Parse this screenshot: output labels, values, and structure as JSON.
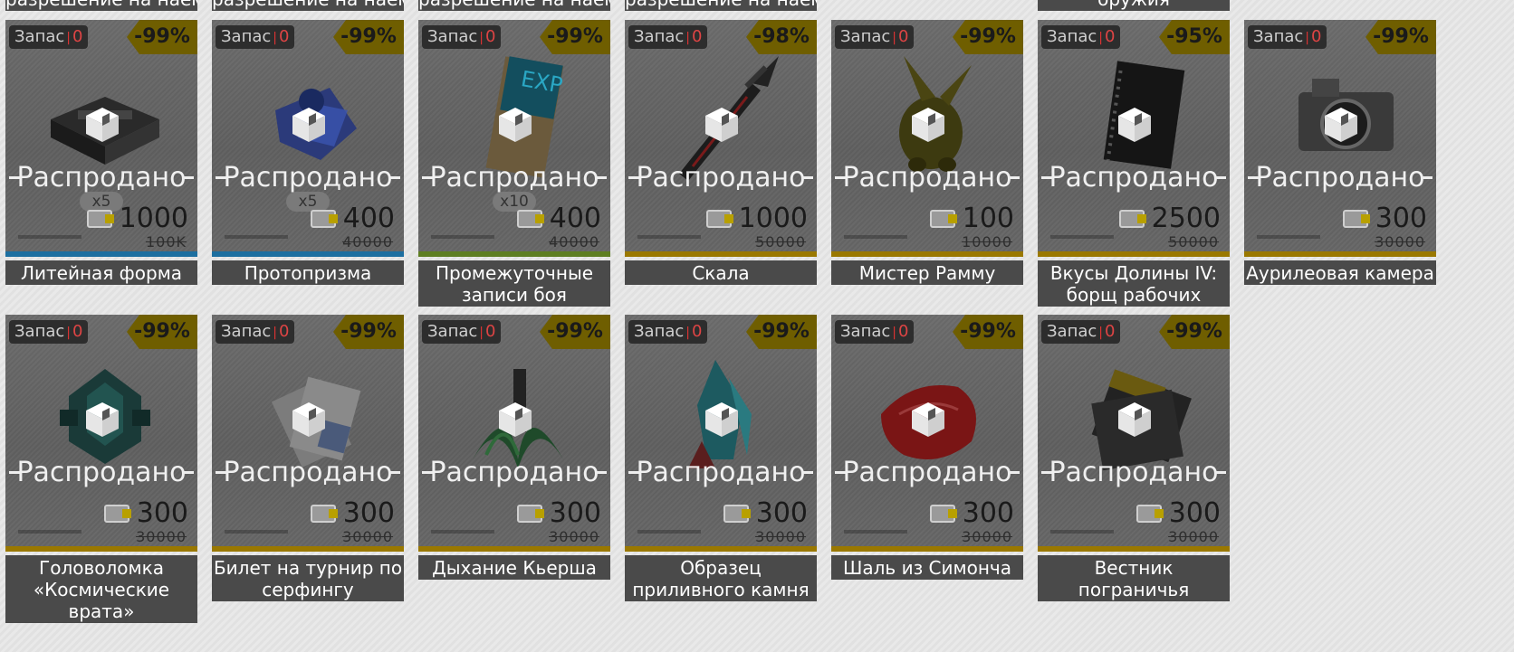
{
  "sold_label": "Распродано",
  "stock_label": "Запас",
  "stock_sep": "|",
  "top_labels": [
    "разрешение на наем",
    "разрешение на наем",
    "разрешение на наем",
    "разрешение на наем",
    "оружия"
  ],
  "rows": [
    [
      {
        "name": "Литейная форма",
        "stock": "0",
        "discount": "-99%",
        "price": "1000",
        "old_price": "100K",
        "qty": "x5",
        "rarity_color": "#1d6fa0",
        "icon": "mold-icon"
      },
      {
        "name": "Протопризма",
        "stock": "0",
        "discount": "-99%",
        "price": "400",
        "old_price": "40000",
        "qty": "x5",
        "rarity_color": "#1d6fa0",
        "icon": "prism-icon"
      },
      {
        "name": "Промежуточные записи боя",
        "stock": "0",
        "discount": "-99%",
        "price": "400",
        "old_price": "40000",
        "qty": "x10",
        "rarity_color": "#5e7e22",
        "icon": "exp-record-icon"
      },
      {
        "name": "Скала",
        "stock": "0",
        "discount": "-98%",
        "price": "1000",
        "old_price": "50000",
        "qty": "",
        "rarity_color": "#9a7800",
        "icon": "sword-icon"
      },
      {
        "name": "Мистер Рамму",
        "stock": "0",
        "discount": "-99%",
        "price": "100",
        "old_price": "10000",
        "qty": "",
        "rarity_color": "#9a7800",
        "icon": "figurine-icon"
      },
      {
        "name": "Вкусы Долины IV: борщ рабочих",
        "stock": "0",
        "discount": "-95%",
        "price": "2500",
        "old_price": "50000",
        "qty": "",
        "rarity_color": "#9a7800",
        "icon": "book-icon"
      },
      {
        "name": "Аурилеовая камера",
        "stock": "0",
        "discount": "-99%",
        "price": "300",
        "old_price": "30000",
        "qty": "",
        "rarity_color": "#9a7800",
        "icon": "camera-icon"
      }
    ],
    [
      {
        "name": "Головоломка «Космические врата»",
        "stock": "0",
        "discount": "-99%",
        "price": "300",
        "old_price": "30000",
        "qty": "",
        "rarity_color": "#9a7800",
        "icon": "puzzle-icon"
      },
      {
        "name": "Билет на турнир по серфингу",
        "stock": "0",
        "discount": "-99%",
        "price": "300",
        "old_price": "30000",
        "qty": "",
        "rarity_color": "#9a7800",
        "icon": "ticket-card-icon"
      },
      {
        "name": "Дыхание Кьерша",
        "stock": "0",
        "discount": "-99%",
        "price": "300",
        "old_price": "30000",
        "qty": "",
        "rarity_color": "#9a7800",
        "icon": "plant-bottle-icon"
      },
      {
        "name": "Образец приливного камня",
        "stock": "0",
        "discount": "-99%",
        "price": "300",
        "old_price": "30000",
        "qty": "",
        "rarity_color": "#9a7800",
        "icon": "crystal-icon"
      },
      {
        "name": "Шаль из Симонча",
        "stock": "0",
        "discount": "-99%",
        "price": "300",
        "old_price": "30000",
        "qty": "",
        "rarity_color": "#9a7800",
        "icon": "shawl-icon"
      },
      {
        "name": "Вестник пограничья",
        "stock": "0",
        "discount": "-99%",
        "price": "300",
        "old_price": "30000",
        "qty": "",
        "rarity_color": "#9a7800",
        "icon": "magazine-icon"
      }
    ]
  ]
}
